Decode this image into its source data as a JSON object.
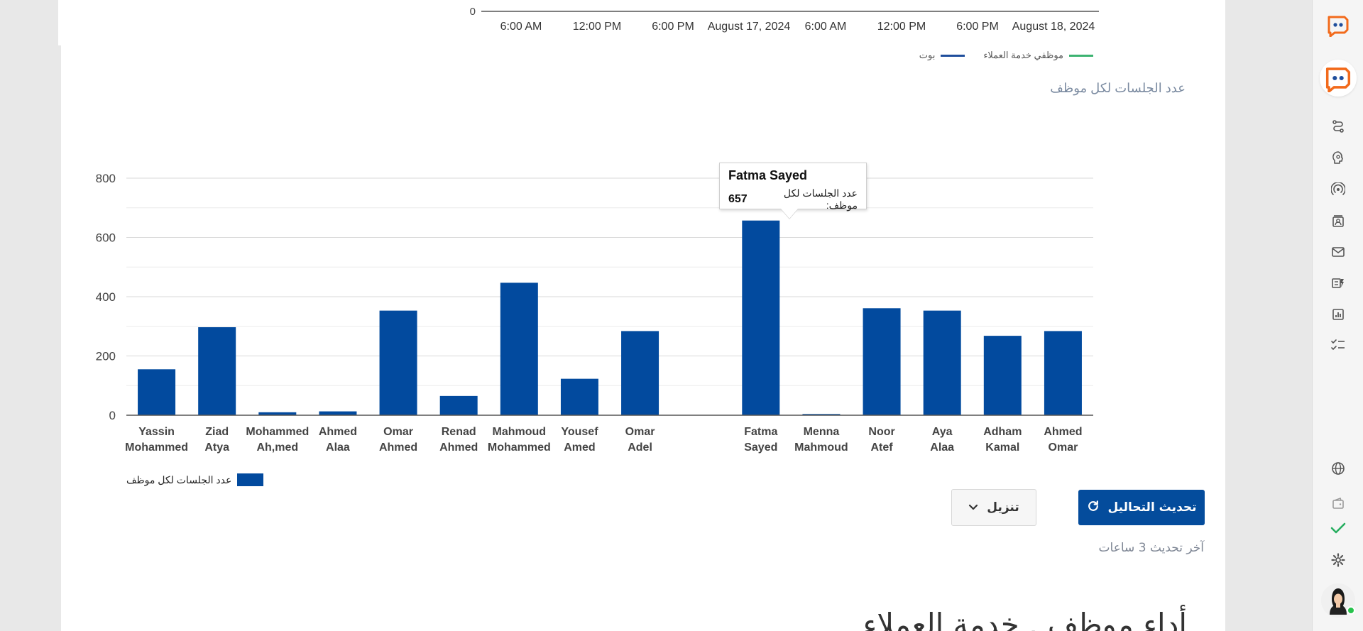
{
  "top_chart": {
    "y_zero_label": "0",
    "x_ticks": [
      "6:00 AM",
      "12:00 PM",
      "6:00 PM",
      "August 17, 2024",
      "6:00 AM",
      "12:00 PM",
      "6:00 PM",
      "August 18, 2024"
    ],
    "legend": [
      {
        "label": "موظفي خدمة العملاء",
        "color": "#3cb371"
      },
      {
        "label": "بوت",
        "color": "#1f4e9c"
      }
    ]
  },
  "sessions_section": {
    "title": "عدد الجلسات لكل موظف"
  },
  "chart_data": {
    "type": "bar",
    "title": "",
    "ylim": [
      0,
      800
    ],
    "y_ticks": [
      0,
      200,
      400,
      600,
      800
    ],
    "grid": true,
    "bar_color": "#024a9e",
    "categories": [
      [
        "Yassin",
        "Mohammed"
      ],
      [
        "Ziad",
        "Atya"
      ],
      [
        "Mohammed",
        "Ah,med"
      ],
      [
        "Ahmed",
        "Alaa"
      ],
      [
        "Omar",
        "Ahmed"
      ],
      [
        "Renad",
        "Ahmed"
      ],
      [
        "Mahmoud",
        "Mohammed"
      ],
      [
        "Yousef",
        "Amed"
      ],
      [
        "Omar",
        "Adel"
      ],
      [
        "",
        ""
      ],
      [
        "Fatma",
        "Sayed"
      ],
      [
        "Menna",
        "Mahmoud"
      ],
      [
        "Noor",
        "Atef"
      ],
      [
        "Aya",
        "Alaa"
      ],
      [
        "Adham",
        "Kamal"
      ],
      [
        "Ahmed",
        "Omar"
      ]
    ],
    "series": [
      {
        "name": "عدد الجلسات لكل موظف",
        "values": [
          155,
          297,
          10,
          13,
          353,
          65,
          447,
          123,
          284,
          0,
          657,
          4,
          361,
          353,
          268,
          284
        ]
      }
    ],
    "legend_position": "bottom-left"
  },
  "tooltip": {
    "name": "Fatma Sayed",
    "value": "657",
    "label": "عدد الجلسات لكل موظف:"
  },
  "actions": {
    "refresh_label": "تحديث التحاليل",
    "download_label": "تنزيل",
    "last_update": "آخر تحديث 3 ساعات"
  },
  "next_section": {
    "heading": "أداء موظف . خدمة العملاء"
  },
  "sidebar": {
    "items": [
      "logo-icon",
      "bot-logo-icon",
      "flow-icon",
      "brain-icon",
      "broadcast-icon",
      "contacts-icon",
      "mail-icon",
      "channels-icon",
      "analytics-icon",
      "checklist-icon",
      "globe-icon",
      "wallet-icon",
      "check-icon",
      "settings-icon"
    ]
  }
}
